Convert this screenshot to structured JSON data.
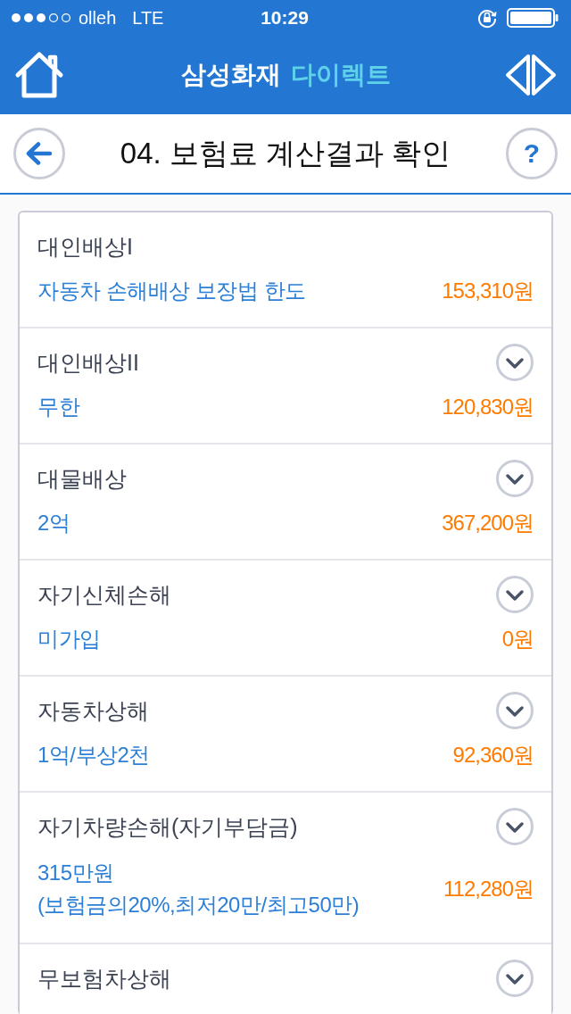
{
  "status_bar": {
    "carrier": "olleh",
    "network": "LTE",
    "time": "10:29"
  },
  "nav_bar": {
    "brand": "삼성화재",
    "brand_accent": "다이렉트"
  },
  "page_header": {
    "title": "04. 보험료 계산결과 확인",
    "help_label": "?"
  },
  "coverages": [
    {
      "title": "대인배상I",
      "details": [
        "자동차 손해배상 보장법 한도"
      ],
      "premium": "153,310원",
      "expandable": false
    },
    {
      "title": "대인배상II",
      "details": [
        "무한"
      ],
      "premium": "120,830원",
      "expandable": true
    },
    {
      "title": "대물배상",
      "details": [
        "2억"
      ],
      "premium": "367,200원",
      "expandable": true
    },
    {
      "title": "자기신체손해",
      "details": [
        "미가입"
      ],
      "premium": "0원",
      "expandable": true
    },
    {
      "title": "자동차상해",
      "details": [
        "1억/부상2천"
      ],
      "premium": "92,360원",
      "expandable": true
    },
    {
      "title": "자기차량손해(자기부담금)",
      "details": [
        "315만원",
        "(보험금의20%,최저20만/최고50만)"
      ],
      "premium": "112,280원",
      "expandable": true
    },
    {
      "title": "무보험차상해",
      "expandable": true
    }
  ]
}
